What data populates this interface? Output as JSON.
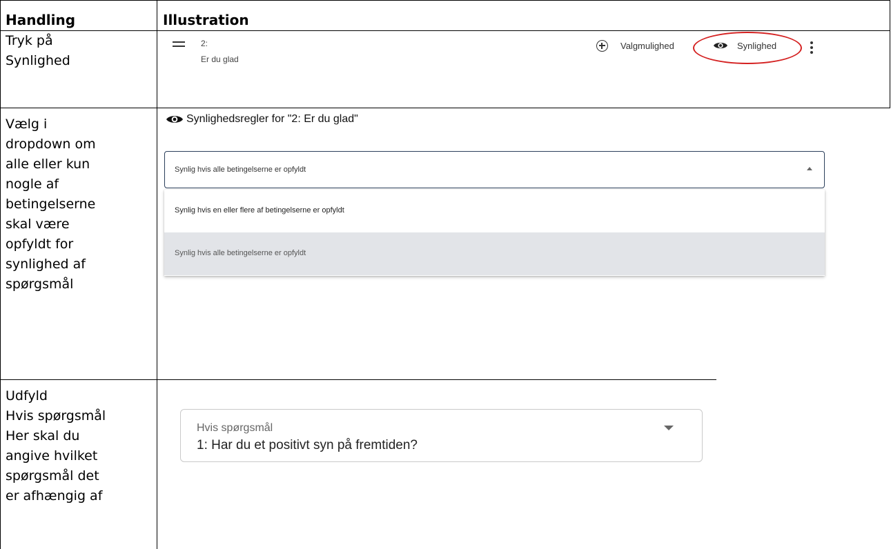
{
  "table": {
    "headers": [
      "Handling",
      "Illustration"
    ],
    "rows": [
      {
        "handling": [
          "Tryk på",
          "Synlighed"
        ]
      },
      {
        "handling": [
          "Vælg i",
          "dropdown om",
          "alle eller kun",
          "nogle af",
          "betingelserne",
          "skal være",
          "opfyldt for",
          "synlighed af",
          "spørgsmål"
        ]
      },
      {
        "handling": [
          "Udfyld",
          "Hvis spørgsmål",
          "Her skal du",
          "angive hvilket",
          "spørgsmål det",
          "er afhængig af"
        ]
      }
    ]
  },
  "row1": {
    "question_number": "2:",
    "question_text": "Er du glad",
    "add_option_label": "Valgmulighed",
    "visibility_label": "Synlighed",
    "icons": [
      "drag-handle-icon",
      "add-circle-icon",
      "eye-icon",
      "more-vert-icon"
    ],
    "highlight_color": "#d42020"
  },
  "row2": {
    "title": "Synlighedsregler for \"2: Er du glad\"",
    "select_value": "Synlig hvis alle betingelserne er opfyldt",
    "options": [
      "Synlig hvis en eller flere af betingelserne er opfyldt",
      "Synlig hvis alle betingelserne er opfyldt"
    ],
    "selected_index": 1,
    "icons": [
      "eye-icon",
      "caret-up-icon"
    ]
  },
  "row3": {
    "field_label": "Hvis spørgsmål",
    "field_value": "1: Har du et positivt syn på fremtiden?",
    "icons": [
      "caret-down-icon"
    ]
  }
}
